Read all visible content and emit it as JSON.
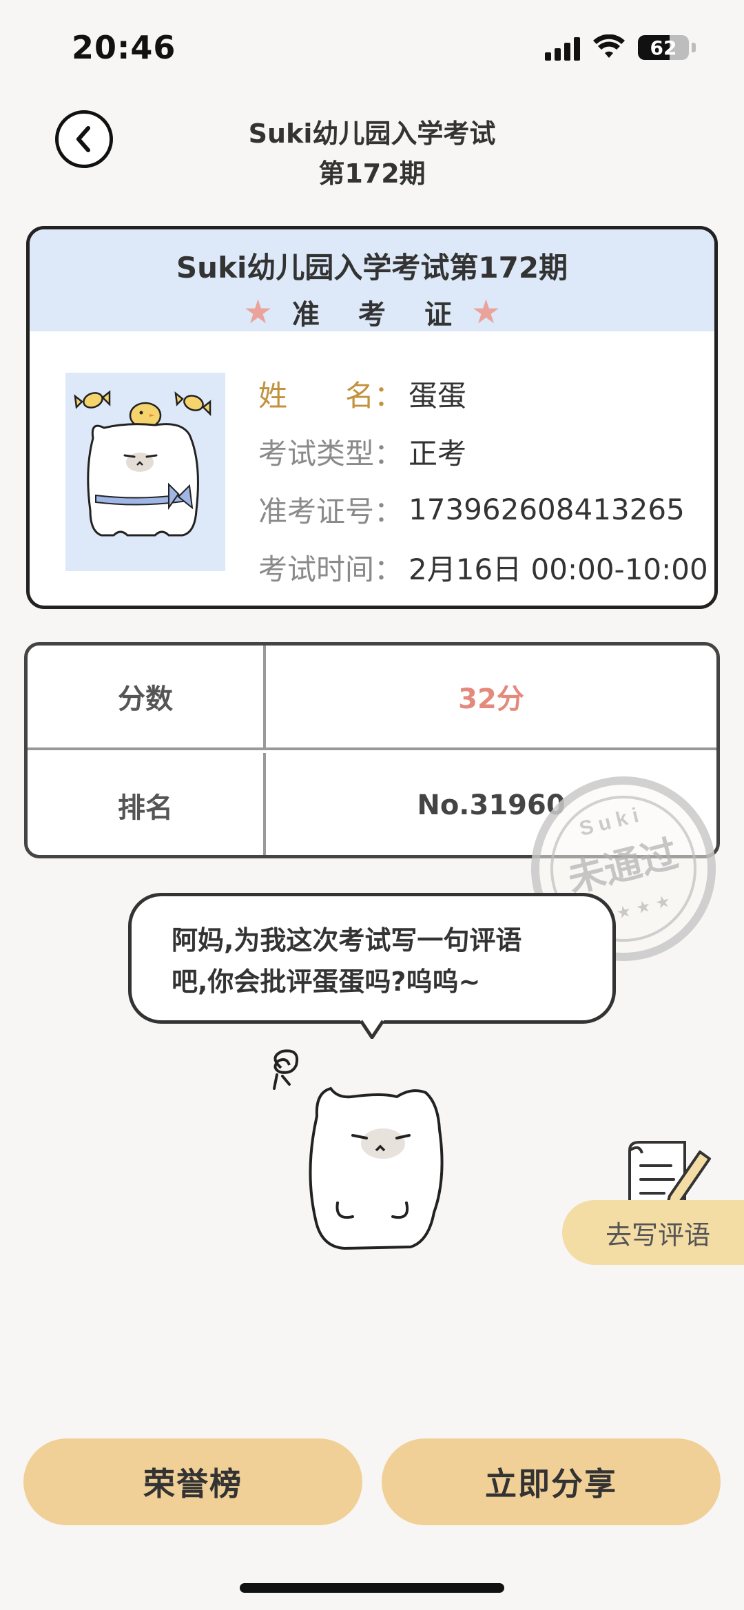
{
  "status_bar": {
    "time": "20:46",
    "battery": "62",
    "battery_level": 0.62
  },
  "header": {
    "title_line1": "Suki幼儿园入学考试",
    "title_line2": "第172期"
  },
  "ticket": {
    "title": "Suki幼儿园入学考试第172期",
    "subtitle": "准考证",
    "rows": [
      {
        "key": "姓　　名：",
        "value": "蛋蛋"
      },
      {
        "key": "考试类型：",
        "value": "正考"
      },
      {
        "key": "准考证号：",
        "value": "173962608413265"
      },
      {
        "key": "考试时间：",
        "value": "2月16日 00:00-10:00"
      }
    ]
  },
  "score_table": {
    "score_label": "分数",
    "score_value": "32分",
    "rank_label": "排名",
    "rank_value": "No.31960"
  },
  "stamp": {
    "brand": "Suki",
    "text": "未通过"
  },
  "bubble": {
    "line1": "阿妈,为我这次考试写一句评语",
    "line2": "吧,你会批评蛋蛋吗?呜呜~"
  },
  "write_comment": {
    "label": "去写评语"
  },
  "buttons": {
    "honor": "荣誉榜",
    "share": "立即分享"
  },
  "colors": {
    "accent": "#f1d097",
    "ticket_header": "#dde9f8",
    "score_red": "#e48a7c",
    "name_key": "#c2923e"
  }
}
